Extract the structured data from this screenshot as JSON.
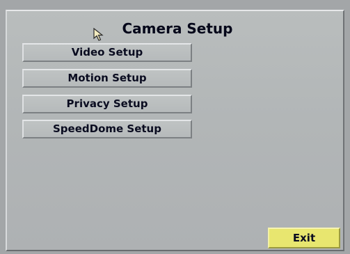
{
  "window": {
    "title": "Camera Setup"
  },
  "menu": {
    "items": [
      {
        "label": "Video Setup"
      },
      {
        "label": "Motion Setup"
      },
      {
        "label": "Privacy Setup"
      },
      {
        "label": "SpeedDome Setup"
      }
    ]
  },
  "footer": {
    "exit_label": "Exit"
  },
  "colors": {
    "panel": "#b2b6b7",
    "exit_button": "#e8e66f",
    "text": "#0a0c20"
  },
  "icons": {
    "cursor": "mouse-pointer-icon"
  }
}
